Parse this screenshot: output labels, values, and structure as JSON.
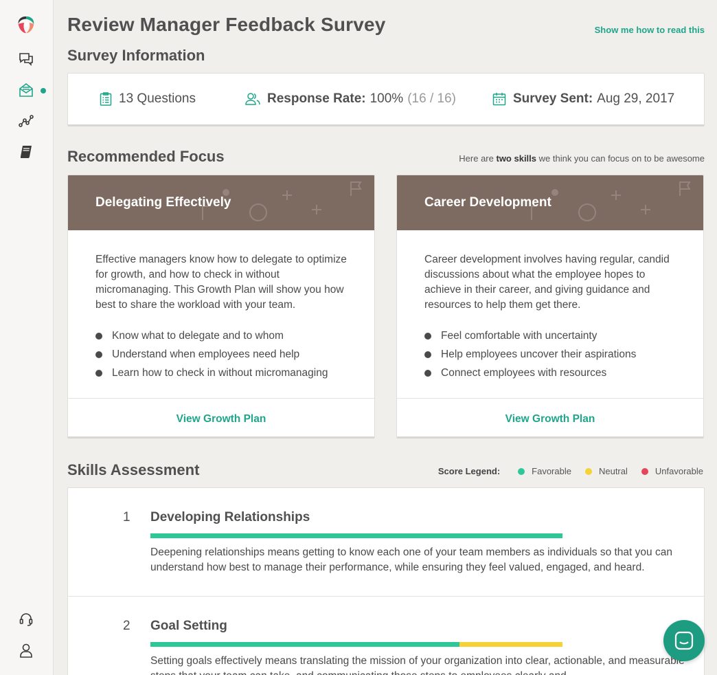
{
  "page": {
    "title": "Review Manager Feedback Survey",
    "help_link": "Show me how to read this"
  },
  "survey_info": {
    "section_title": "Survey Information",
    "questions": "13 Questions",
    "response_label": "Response Rate:",
    "response_value": "100%",
    "response_detail": "(16 / 16)",
    "sent_label": "Survey Sent:",
    "sent_value": "Aug 29, 2017"
  },
  "focus": {
    "section_title": "Recommended Focus",
    "note_pre": "Here are ",
    "note_bold": "two skills",
    "note_post": " we think you can focus on to be awesome",
    "cards": [
      {
        "title": "Delegating Effectively",
        "description": "Effective managers know how to delegate to optimize for growth, and how to check in without micromanaging. This Growth Plan will show you how best to share the workload with your team.",
        "bullets": [
          "Know what to delegate and to whom",
          "Understand when employees need help",
          "Learn how to check in without micromanaging"
        ],
        "action": "View Growth Plan"
      },
      {
        "title": "Career Development",
        "description": "Career development involves having regular, candid discussions about what the employee hopes to achieve in their career, and giving guidance and resources to help them get there.",
        "bullets": [
          "Feel comfortable with uncertainty",
          "Help employees uncover their aspirations",
          "Connect employees with resources"
        ],
        "action": "View Growth Plan"
      }
    ]
  },
  "skills": {
    "section_title": "Skills Assessment",
    "legend": {
      "title": "Score Legend:",
      "items": [
        {
          "label": "Favorable",
          "color": "#2ec898"
        },
        {
          "label": "Neutral",
          "color": "#f5d336"
        },
        {
          "label": "Unfavorable",
          "color": "#e5465b"
        }
      ]
    },
    "items": [
      {
        "number": "1",
        "name": "Developing Relationships",
        "favorable_pct": 100,
        "neutral_pct": 0,
        "description": "Deepening relationships means getting to know each one of your team members as individuals so that you can understand how best to manage their performance, while ensuring they feel valued, engaged, and heard."
      },
      {
        "number": "2",
        "name": "Goal Setting",
        "favorable_pct": 75,
        "neutral_pct": 25,
        "description": "Setting goals effectively means translating the mission of your organization into clear, actionable, and measurable steps that your team can take, and communicating those steps to employees clearly and"
      }
    ]
  },
  "sidebar": {
    "icons": [
      "logo-icon",
      "chat-icon",
      "survey-icon",
      "analytics-icon",
      "book-icon",
      "support-icon",
      "profile-icon"
    ]
  },
  "colors": {
    "accent": "#1fa58a",
    "card_header": "#7d6b62",
    "favorable": "#2ec898",
    "neutral": "#f5d336",
    "unfavorable": "#e5465b"
  }
}
